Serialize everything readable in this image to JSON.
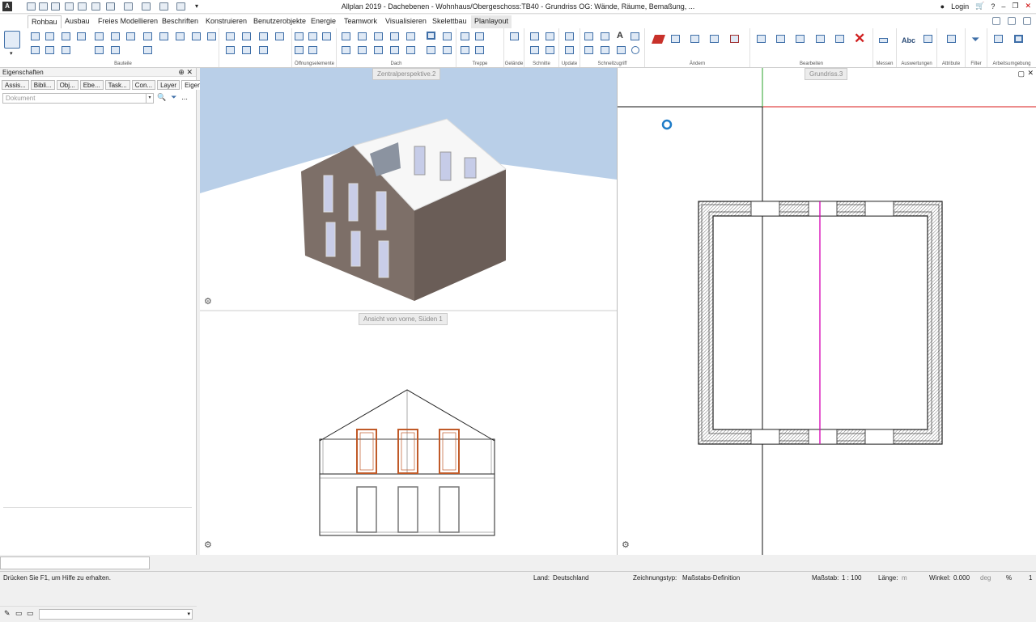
{
  "titlebar": {
    "app_letter": "A",
    "title": "Allplan 2019 - Dachebenen - Wohnhaus/Obergeschoss:TB40 - Grundriss OG: Wände, Räume, Bemaßung, ...",
    "login": "Login",
    "minimize": "–",
    "maximize": "❐",
    "close": "✕"
  },
  "tabs": [
    "Rohbau",
    "Ausbau",
    "Freies Modellieren",
    "Beschriften",
    "Konstruieren",
    "Benutzerobjekte",
    "Energie",
    "Teamwork",
    "Visualisieren",
    "Skelettbau",
    "Planlayout"
  ],
  "ribbon_groups": [
    "Bauteile",
    "Öffnungselemente",
    "Dach",
    "Treppe",
    "Gelände",
    "Schnitte",
    "Update",
    "Schnellzugriff",
    "Ändern",
    "Bearbeiten",
    "Messen",
    "Auswertungen",
    "Attribute",
    "Filter",
    "Arbeitsumgebung"
  ],
  "ribbon_text_icons": {
    "text_a": "A",
    "abc": "Abc"
  },
  "left_panel": {
    "header": "Eigenschaften",
    "pin": "⊕",
    "close": "✕",
    "tabs": [
      "Assis...",
      "Bibli...",
      "Obj...",
      "Ebe...",
      "Task...",
      "Con...",
      "Layer",
      "Eigen..."
    ],
    "document_placeholder": "Dokument",
    "dropdown_arrow": "▾",
    "more": "..."
  },
  "viewports": {
    "perspective_label": "Zentralperspektive.2",
    "elevation_label": "Ansicht von vorne, Süden 1",
    "plan_label": "Grundriss.3"
  },
  "status": {
    "help": "Drücken Sie F1, um Hilfe zu erhalten.",
    "land_label": "Land:",
    "land_value": "Deutschland",
    "zeichnungstyp_label": "Zeichnungstyp:",
    "zeichnungstyp_value": "Maßstabs-Definition",
    "massstab_label": "Maßstab:",
    "massstab_value": "1 : 100",
    "laenge_label": "Länge:",
    "laenge_unit": "m",
    "winkel_label": "Winkel:",
    "winkel_value": "0.000",
    "winkel_unit": "deg",
    "percent": "%",
    "percent_value": "1"
  },
  "colors": {
    "sky": "#b9cfe8",
    "ground": "#ffffff",
    "brick": "#7d6f68",
    "axis_red": "#d81818",
    "axis_green": "#2aa02a",
    "magenta": "#d600b4",
    "window_frame_orange": "#c05a28"
  }
}
